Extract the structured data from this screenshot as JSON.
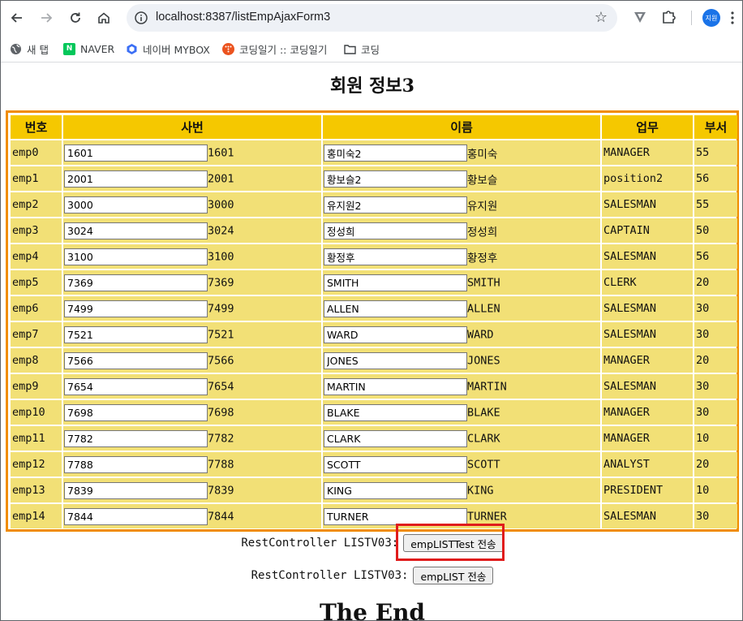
{
  "browser": {
    "url": "localhost:8387/listEmpAjaxForm3",
    "profile_initials": "지원",
    "bookmarks": [
      {
        "label": "새 탭",
        "icon": "globe-icon"
      },
      {
        "label": "NAVER",
        "icon": "naver-icon",
        "color": "#03c75a"
      },
      {
        "label": "네이버 MYBOX",
        "icon": "mybox-icon",
        "color": "#3b6ff5"
      },
      {
        "label": "코딩일기 :: 코딩일기",
        "icon": "tistory-icon",
        "color": "#eb531f"
      },
      {
        "label": "코딩",
        "icon": "folder-icon"
      }
    ]
  },
  "page": {
    "title": "회원 정보3",
    "columns": [
      "번호",
      "사번",
      "이름",
      "업무",
      "부서"
    ],
    "rows": [
      {
        "no": "emp0",
        "empno_input": "1601",
        "empno": "1601",
        "name_input": "홍미숙2",
        "name": "홍미숙",
        "job": "MANAGER",
        "dept": "55"
      },
      {
        "no": "emp1",
        "empno_input": "2001",
        "empno": "2001",
        "name_input": "황보슬2",
        "name": "황보슬",
        "job": "position2",
        "dept": "56"
      },
      {
        "no": "emp2",
        "empno_input": "3000",
        "empno": "3000",
        "name_input": "유지원2",
        "name": "유지원",
        "job": "SALESMAN",
        "dept": "55"
      },
      {
        "no": "emp3",
        "empno_input": "3024",
        "empno": "3024",
        "name_input": "정성희",
        "name": "정성희",
        "job": "CAPTAIN",
        "dept": "50"
      },
      {
        "no": "emp4",
        "empno_input": "3100",
        "empno": "3100",
        "name_input": "황정후",
        "name": "황정후",
        "job": "SALESMAN",
        "dept": "56"
      },
      {
        "no": "emp5",
        "empno_input": "7369",
        "empno": "7369",
        "name_input": "SMITH",
        "name": "SMITH",
        "job": "CLERK",
        "dept": "20"
      },
      {
        "no": "emp6",
        "empno_input": "7499",
        "empno": "7499",
        "name_input": "ALLEN",
        "name": "ALLEN",
        "job": "SALESMAN",
        "dept": "30"
      },
      {
        "no": "emp7",
        "empno_input": "7521",
        "empno": "7521",
        "name_input": "WARD",
        "name": "WARD",
        "job": "SALESMAN",
        "dept": "30"
      },
      {
        "no": "emp8",
        "empno_input": "7566",
        "empno": "7566",
        "name_input": "JONES",
        "name": "JONES",
        "job": "MANAGER",
        "dept": "20"
      },
      {
        "no": "emp9",
        "empno_input": "7654",
        "empno": "7654",
        "name_input": "MARTIN",
        "name": "MARTIN",
        "job": "SALESMAN",
        "dept": "30"
      },
      {
        "no": "emp10",
        "empno_input": "7698",
        "empno": "7698",
        "name_input": "BLAKE",
        "name": "BLAKE",
        "job": "MANAGER",
        "dept": "30"
      },
      {
        "no": "emp11",
        "empno_input": "7782",
        "empno": "7782",
        "name_input": "CLARK",
        "name": "CLARK",
        "job": "MANAGER",
        "dept": "10"
      },
      {
        "no": "emp12",
        "empno_input": "7788",
        "empno": "7788",
        "name_input": "SCOTT",
        "name": "SCOTT",
        "job": "ANALYST",
        "dept": "20"
      },
      {
        "no": "emp13",
        "empno_input": "7839",
        "empno": "7839",
        "name_input": "KING",
        "name": "KING",
        "job": "PRESIDENT",
        "dept": "10"
      },
      {
        "no": "emp14",
        "empno_input": "7844",
        "empno": "7844",
        "name_input": "TURNER",
        "name": "TURNER",
        "job": "SALESMAN",
        "dept": "30"
      }
    ],
    "rest1": {
      "label": "RestController LISTV03:",
      "button": "empLISTTest 전송"
    },
    "rest2": {
      "label": "RestController LISTV03:",
      "button": "empLIST 전송"
    },
    "footer": "The End"
  },
  "colors": {
    "header_bg": "#f5c800",
    "cell_bg": "#f2e076",
    "frame_border": "#f08c00",
    "highlight": "#e01c1c"
  }
}
